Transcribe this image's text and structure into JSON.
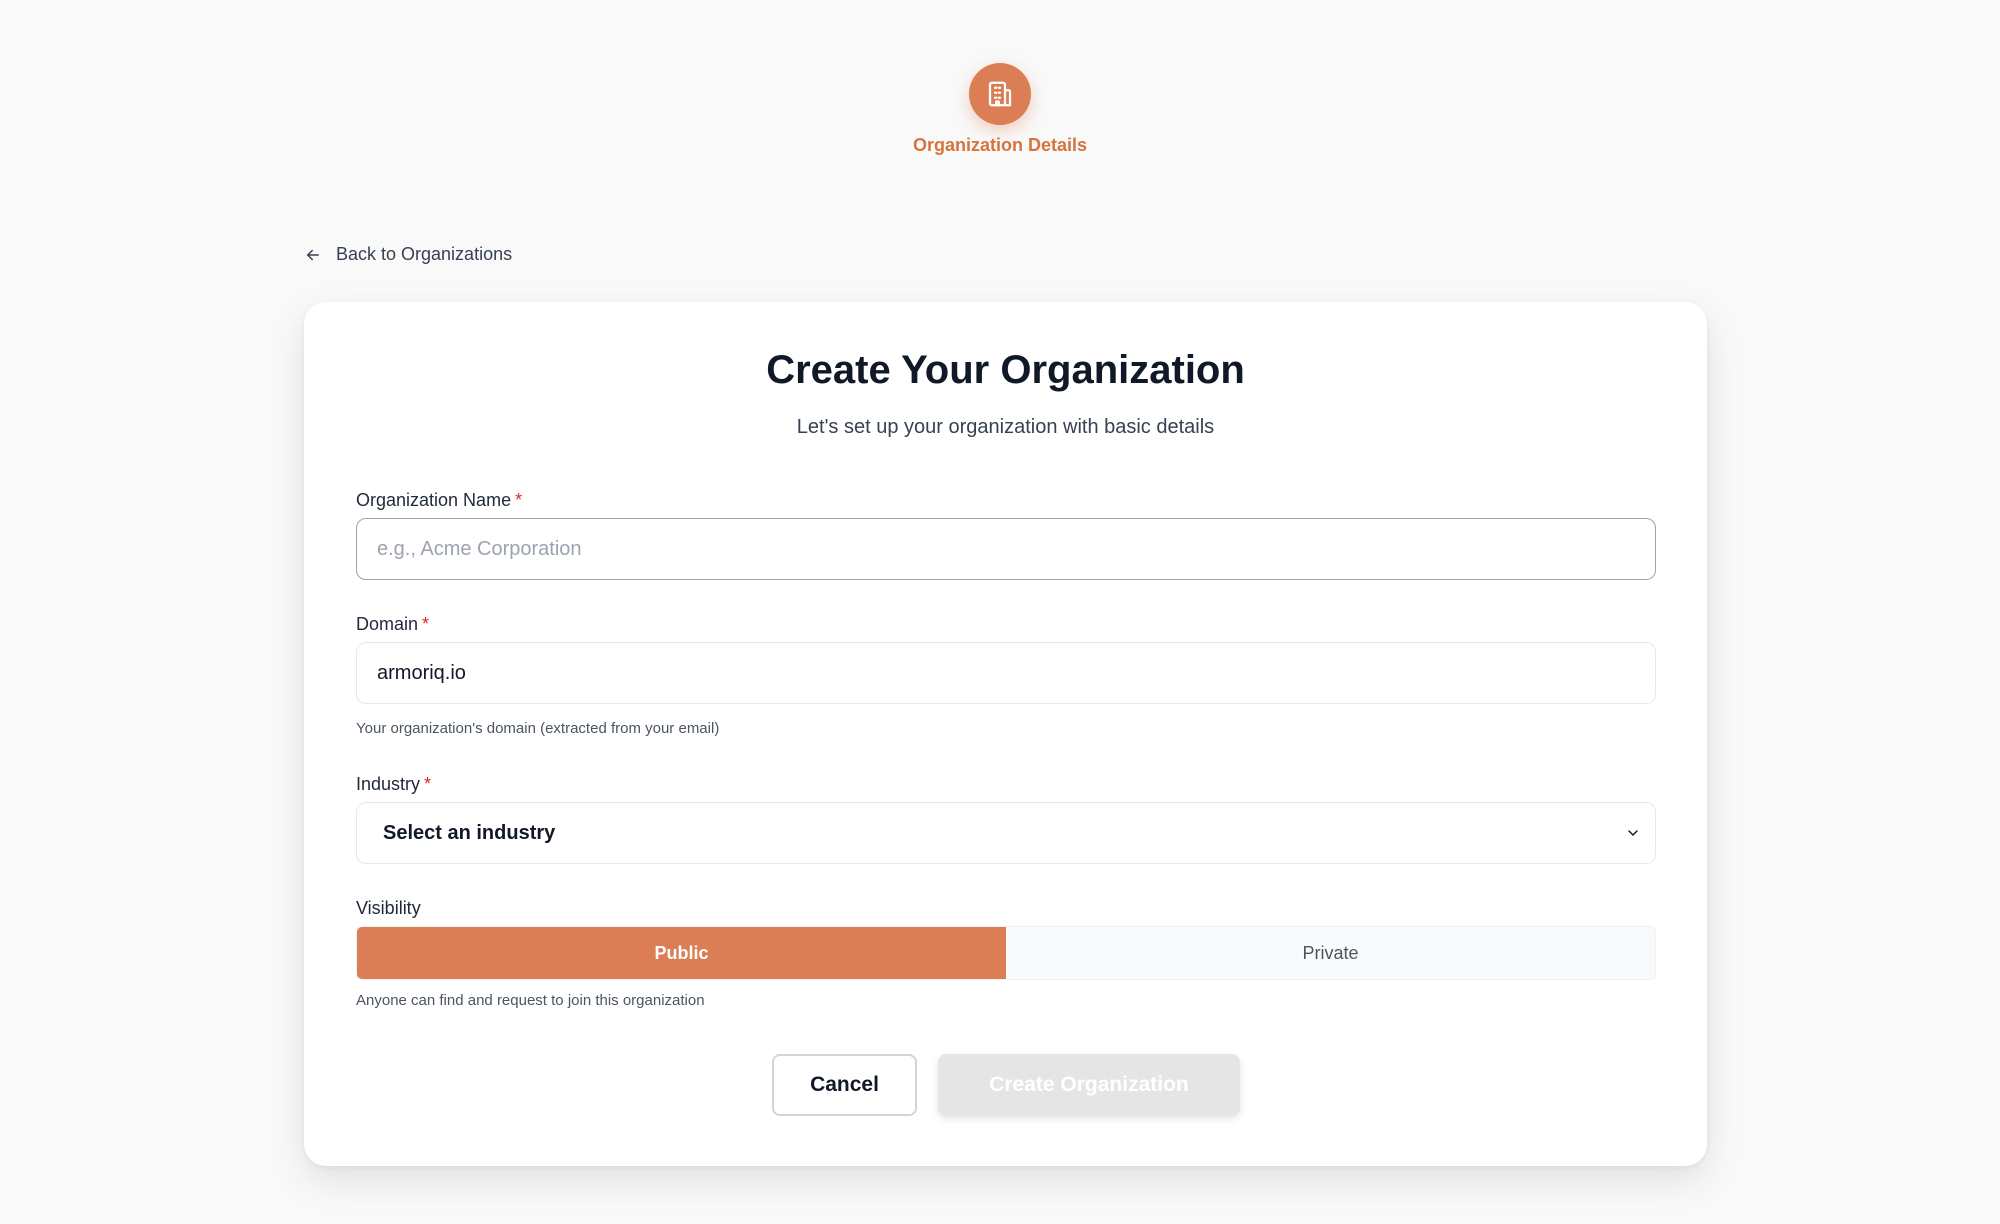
{
  "stepper": {
    "step_label": "Organization Details",
    "step_icon": "building-icon"
  },
  "nav": {
    "back_label": "Back to Organizations"
  },
  "card": {
    "title": "Create Your Organization",
    "subtitle": "Let's set up your organization with basic details"
  },
  "form": {
    "org_name": {
      "label": "Organization Name",
      "required_mark": "*",
      "placeholder": "e.g., Acme Corporation",
      "value": ""
    },
    "domain": {
      "label": "Domain",
      "required_mark": "*",
      "value": "armoriq.io",
      "help": "Your organization's domain (extracted from your email)"
    },
    "industry": {
      "label": "Industry",
      "required_mark": "*",
      "selected": "Select an industry"
    },
    "visibility": {
      "label": "Visibility",
      "options": [
        "Public",
        "Private"
      ],
      "selected": "Public",
      "help": "Anyone can find and request to join this organization"
    }
  },
  "actions": {
    "cancel_label": "Cancel",
    "create_label": "Create Organization"
  },
  "colors": {
    "accent": "#db7e55",
    "accent_text": "#d6743e",
    "required": "#dc2626",
    "disabled_button": "#e5e5e5"
  }
}
